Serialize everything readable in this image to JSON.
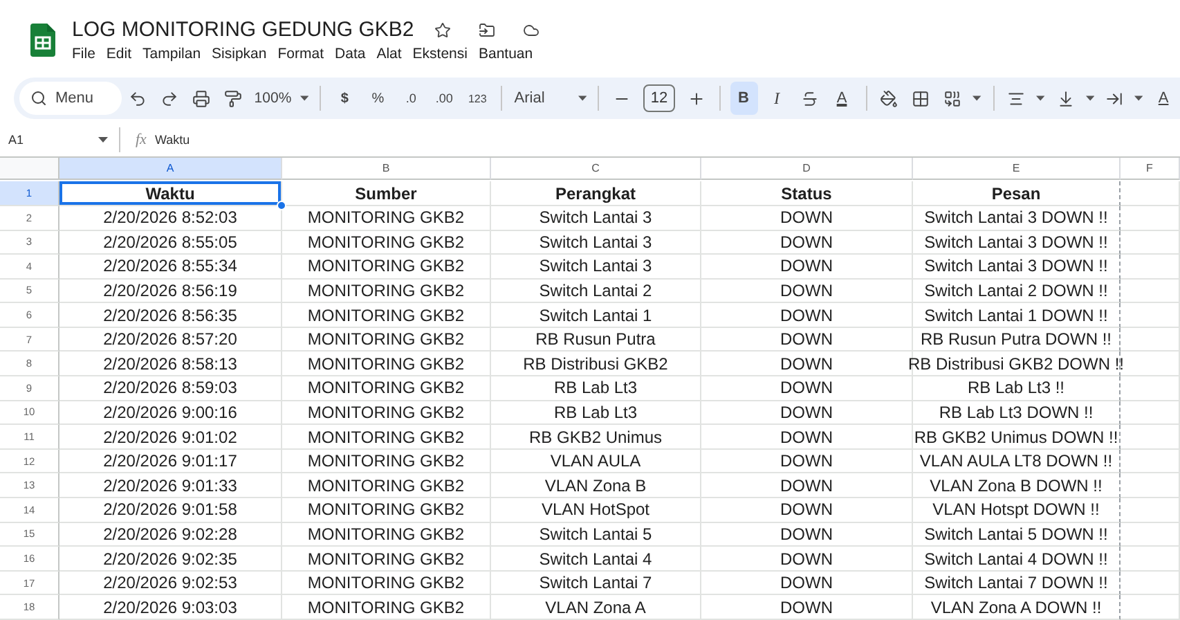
{
  "document": {
    "title": "LOG MONITORING GEDUNG GKB2",
    "menus": [
      "File",
      "Edit",
      "Tampilan",
      "Sisipkan",
      "Format",
      "Data",
      "Alat",
      "Ekstensi",
      "Bantuan"
    ]
  },
  "toolbar": {
    "search_label": "Menu",
    "zoom": "100%",
    "currency": "$",
    "percent": "%",
    "decrease_decimal": ".0",
    "increase_decimal": ".00",
    "more_formats": "123",
    "font": "Arial",
    "font_size": "12",
    "bold": {
      "label": "B",
      "selected": true
    },
    "italic": {
      "label": "I",
      "selected": false
    },
    "text_color": "A",
    "cut_off": "A"
  },
  "formula_bar": {
    "cell_ref": "A1",
    "fx": "fx",
    "value": "Waktu"
  },
  "columns": [
    {
      "letter": "A",
      "selected": true
    },
    {
      "letter": "B",
      "selected": false
    },
    {
      "letter": "C",
      "selected": false
    },
    {
      "letter": "D",
      "selected": false
    },
    {
      "letter": "E",
      "selected": false
    },
    {
      "letter": "F",
      "selected": false
    }
  ],
  "rows": [
    {
      "number": "1",
      "selected": true,
      "kind": "header",
      "cells": [
        "Waktu",
        "Sumber",
        "Perangkat",
        "Status",
        "Pesan"
      ]
    },
    {
      "number": "2",
      "selected": false,
      "kind": "data",
      "cells": [
        "2/20/2026 8:52:03",
        "MONITORING GKB2",
        "Switch Lantai 3",
        "DOWN",
        "Switch Lantai 3 DOWN !!"
      ]
    },
    {
      "number": "3",
      "selected": false,
      "kind": "data",
      "cells": [
        "2/20/2026 8:55:05",
        "MONITORING GKB2",
        "Switch Lantai 3",
        "DOWN",
        "Switch Lantai 3 DOWN !!"
      ]
    },
    {
      "number": "4",
      "selected": false,
      "kind": "data",
      "cells": [
        "2/20/2026 8:55:34",
        "MONITORING GKB2",
        "Switch Lantai 3",
        "DOWN",
        "Switch Lantai 3 DOWN !!"
      ]
    },
    {
      "number": "5",
      "selected": false,
      "kind": "data",
      "cells": [
        "2/20/2026 8:56:19",
        "MONITORING GKB2",
        "Switch Lantai 2",
        "DOWN",
        "Switch Lantai 2 DOWN !!"
      ]
    },
    {
      "number": "6",
      "selected": false,
      "kind": "data",
      "cells": [
        "2/20/2026 8:56:35",
        "MONITORING GKB2",
        "Switch Lantai 1",
        "DOWN",
        "Switch Lantai 1 DOWN !!"
      ]
    },
    {
      "number": "7",
      "selected": false,
      "kind": "data",
      "cells": [
        "2/20/2026 8:57:20",
        "MONITORING GKB2",
        "RB Rusun Putra",
        "DOWN",
        "RB Rusun Putra DOWN !!"
      ]
    },
    {
      "number": "8",
      "selected": false,
      "kind": "data",
      "cells": [
        "2/20/2026 8:58:13",
        "MONITORING GKB2",
        "RB Distribusi GKB2",
        "DOWN",
        "RB Distribusi GKB2 DOWN !!"
      ]
    },
    {
      "number": "9",
      "selected": false,
      "kind": "data",
      "cells": [
        "2/20/2026 8:59:03",
        "MONITORING GKB2",
        "RB Lab Lt3",
        "DOWN",
        "RB Lab Lt3 !!"
      ]
    },
    {
      "number": "10",
      "selected": false,
      "kind": "data",
      "cells": [
        "2/20/2026 9:00:16",
        "MONITORING GKB2",
        "RB Lab Lt3",
        "DOWN",
        "RB Lab Lt3 DOWN !!"
      ]
    },
    {
      "number": "11",
      "selected": false,
      "kind": "data",
      "cells": [
        "2/20/2026 9:01:02",
        "MONITORING GKB2",
        "RB GKB2 Unimus",
        "DOWN",
        "RB GKB2 Unimus DOWN !!"
      ]
    },
    {
      "number": "12",
      "selected": false,
      "kind": "data",
      "cells": [
        "2/20/2026 9:01:17",
        "MONITORING GKB2",
        "VLAN AULA",
        "DOWN",
        "VLAN AULA LT8 DOWN !!"
      ]
    },
    {
      "number": "13",
      "selected": false,
      "kind": "data",
      "cells": [
        "2/20/2026 9:01:33",
        "MONITORING GKB2",
        "VLAN Zona B",
        "DOWN",
        "VLAN Zona B DOWN !!"
      ]
    },
    {
      "number": "14",
      "selected": false,
      "kind": "data",
      "cells": [
        "2/20/2026 9:01:58",
        "MONITORING GKB2",
        "VLAN HotSpot",
        "DOWN",
        "VLAN Hotspt DOWN !!"
      ]
    },
    {
      "number": "15",
      "selected": false,
      "kind": "data",
      "cells": [
        "2/20/2026 9:02:28",
        "MONITORING GKB2",
        "Switch Lantai 5",
        "DOWN",
        "Switch Lantai 5 DOWN !!"
      ]
    },
    {
      "number": "16",
      "selected": false,
      "kind": "data",
      "cells": [
        "2/20/2026 9:02:35",
        "MONITORING GKB2",
        "Switch Lantai 4",
        "DOWN",
        "Switch Lantai 4 DOWN !!"
      ]
    },
    {
      "number": "17",
      "selected": false,
      "kind": "data",
      "cells": [
        "2/20/2026 9:02:53",
        "MONITORING GKB2",
        "Switch Lantai 7",
        "DOWN",
        "Switch Lantai 7 DOWN !!"
      ]
    },
    {
      "number": "18",
      "selected": false,
      "kind": "data",
      "cells": [
        "2/20/2026 9:03:03",
        "MONITORING GKB2",
        "VLAN Zona A",
        "DOWN",
        "VLAN Zona A DOWN !!"
      ]
    }
  ]
}
